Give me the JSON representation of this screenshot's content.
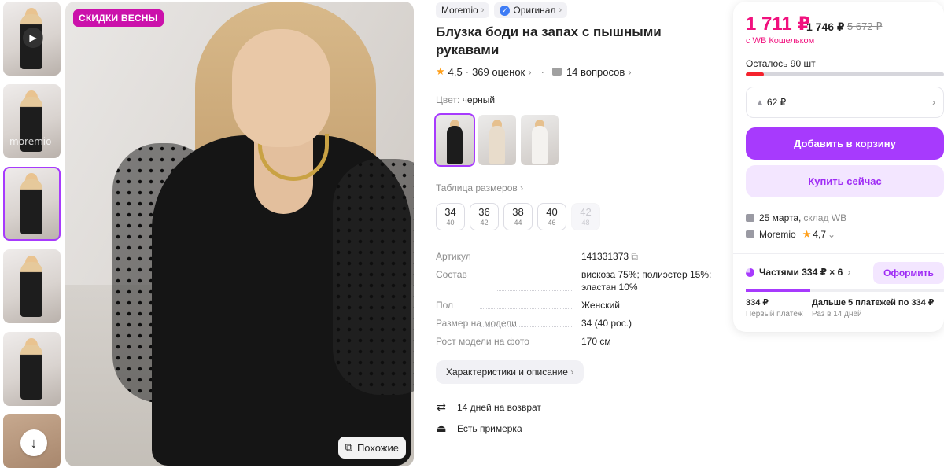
{
  "gallery": {
    "promo_badge": "СКИДКИ ВЕСНЫ",
    "similar_label": "Похожие",
    "watermark": "moremio"
  },
  "product": {
    "brand": "Moremio",
    "original_label": "Оригинал",
    "title": "Блузка боди на запах с пышными рукавами",
    "rating": "4,5",
    "reviews": "369 оценок",
    "questions": "14 вопросов",
    "color_label": "Цвет:",
    "color_value": "черный",
    "color_swatches": [
      {
        "name": "black",
        "body_color": "#1c1c1c"
      },
      {
        "name": "beige",
        "body_color": "#e8dccb"
      },
      {
        "name": "white",
        "body_color": "#f4f2ef"
      }
    ],
    "size_table_label": "Таблица размеров",
    "sizes": [
      {
        "size": "34",
        "ru": "40",
        "available": true
      },
      {
        "size": "36",
        "ru": "42",
        "available": true
      },
      {
        "size": "38",
        "ru": "44",
        "available": true
      },
      {
        "size": "40",
        "ru": "46",
        "available": true
      },
      {
        "size": "42",
        "ru": "48",
        "available": false
      }
    ],
    "specs": [
      {
        "key": "Артикул",
        "value": "141331373"
      },
      {
        "key": "Состав",
        "value": "вискоза 75%; полиэстер 15%; эластан 10%"
      },
      {
        "key": "Пол",
        "value": "Женский"
      },
      {
        "key": "Размер на модели",
        "value": "34 (40 рос.)"
      },
      {
        "key": "Рост модели на фото",
        "value": "170 см"
      }
    ],
    "description_button": "Характеристики и описание",
    "services": [
      {
        "icon": "return-arrows-icon",
        "label": "14 дней на возврат"
      },
      {
        "icon": "hanger-icon",
        "label": "Есть примерка"
      }
    ]
  },
  "buy_panel": {
    "price": "1 711 ₽",
    "price_without_wallet": "1 746 ₽",
    "price_old": "5 672 ₽",
    "wallet_note": "с WB Кошельком",
    "stock_note": "Осталось 90 шт",
    "stock_level": 0.09,
    "bonus": "62 ₽",
    "add_to_cart": "Добавить в корзину",
    "buy_now": "Купить сейчас",
    "delivery_date": "25 марта,",
    "delivery_warehouse": "склад WB",
    "seller": "Moremio",
    "seller_rating": "4,7",
    "installments_label": "Частями 334 ₽ × 6",
    "installments_button": "Оформить",
    "first_payment": "334 ₽",
    "first_payment_note": "Первый платёж",
    "next_payments": "Дальше 5 платежей по 334 ₽",
    "next_payments_note": "Раз в 14 дней"
  },
  "colors": {
    "accent": "#a73afd",
    "price": "#f1117e",
    "promo": "#cb11ab"
  }
}
